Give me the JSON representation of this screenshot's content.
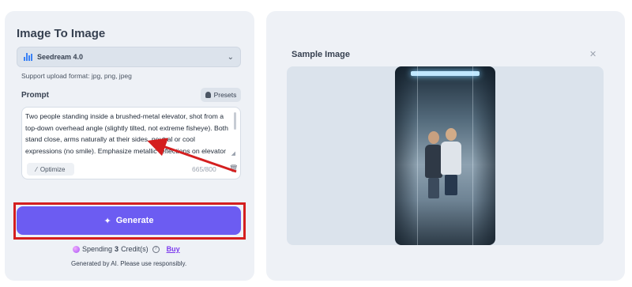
{
  "left": {
    "title": "Image To Image",
    "model": {
      "label": "Seedream 4.0",
      "icon": "bar-chart-icon"
    },
    "support_text": "Support upload format: jpg, png, jpeg",
    "prompt": {
      "label": "Prompt",
      "presets_label": "Presets",
      "text": "Two people standing inside a brushed-metal elevator, shot from a top-down overhead angle (slightly tilted, not extreme fisheye). Both stand close, arms naturally at their sides, neutral or cool expressions (no smile). Emphasize metallic reflections on elevator walls, subtle ambient cold",
      "optimize_label": "Optimize",
      "counter": "665/800"
    },
    "generate_label": "Generate",
    "spending": {
      "prefix": "Spending",
      "amount": "3",
      "suffix": "Credit(s)",
      "buy_label": "Buy"
    },
    "disclaimer": "Generated by AI. Please use responsibly."
  },
  "right": {
    "sample_title": "Sample Image",
    "close_icon": "close-icon"
  },
  "colors": {
    "accent": "#6c5cf2",
    "highlight": "#d41f1f",
    "panel": "#eef1f6"
  }
}
